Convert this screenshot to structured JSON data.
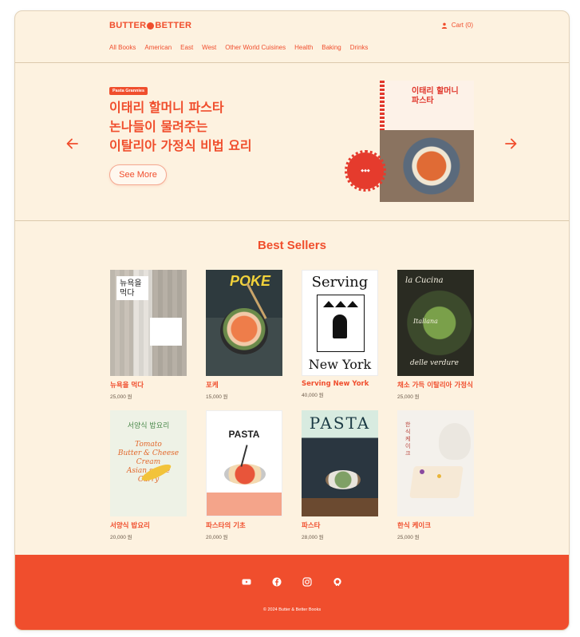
{
  "brand": {
    "logo_left": "BUTTER",
    "logo_right": "BETTER"
  },
  "header": {
    "cart_label": "Cart (0)"
  },
  "nav": [
    "All Books",
    "American",
    "East",
    "West",
    "Other World Cuisines",
    "Health",
    "Baking",
    "Drinks"
  ],
  "hero": {
    "badge": "Pasta Grannies",
    "title_lines": [
      "이태리 할머니 파스타",
      "논나들이 물려주는",
      "이탈리아 가정식 비법 요리"
    ],
    "cta": "See More",
    "cover_title_lines": [
      "이태리 할머니",
      "파스타"
    ]
  },
  "best_sellers": {
    "title": "Best Sellers",
    "books": [
      {
        "name": "뉴욕을 먹다",
        "price": "25,000 원",
        "cover_text": "뉴욕을 먹다"
      },
      {
        "name": "포케",
        "price": "15,000 원",
        "cover_text": "POKE"
      },
      {
        "name": "Serving New York",
        "price": "40,000 원",
        "cover_text": "Serving"
      },
      {
        "name": "채소 가득 이탈리아 가정식",
        "price": "25,000 원",
        "cover_text": "la Cucina"
      },
      {
        "name": "서양식 밥요리",
        "price": "20,000 원",
        "cover_text": "서양식 밥요리"
      },
      {
        "name": "파스타의 기초",
        "price": "20,000 원",
        "cover_text": "PASTA"
      },
      {
        "name": "파스타",
        "price": "28,000 원",
        "cover_text": "PASTA"
      },
      {
        "name": "한식 케이크",
        "price": "25,000 원",
        "cover_text": "한식 케이크"
      }
    ]
  },
  "footer": {
    "icons": [
      "youtube-icon",
      "facebook-icon",
      "instagram-icon",
      "github-icon"
    ],
    "copyright": "© 2024 Butter & Better Books"
  },
  "colors": {
    "accent": "#f04e2d",
    "background": "#fdf2e0",
    "footer": "#f04e2d"
  }
}
